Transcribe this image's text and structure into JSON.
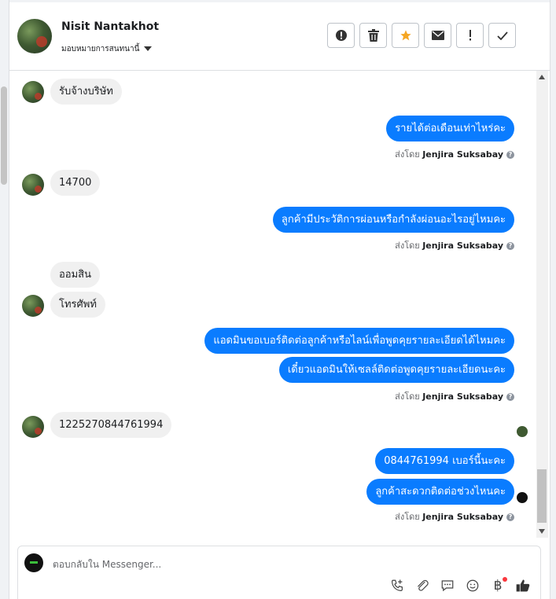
{
  "header": {
    "name": "Nisit Nantakhot",
    "assign_label": "มอบหมายการสนทนานี้",
    "actions": [
      "spam",
      "delete",
      "star",
      "mark-unread",
      "follow-up",
      "done"
    ]
  },
  "messages": {
    "m1": "รับจ้างบริษัท",
    "m2": "รายได้ต่อเดือนเท่าไหร่คะ",
    "m3": "14700",
    "m4": "ลูกค้ามีประวัติการผ่อนหรือกำลังผ่อนอะไรอยู่ไหมคะ",
    "m5": "ออมสิน",
    "m6": "โทรศัพท์",
    "m7": "แอดมินขอเบอร์ติดต่อลูกค้าหรือไลน์เพื่อพูดคุยรายละเอียดได้ไหมคะ",
    "m8": "เดี๋ยวแอดมินให้เซลล์ติดต่อพูดคุยรายละเอียดนะคะ",
    "m9": "1225270844761994",
    "m10": "0844761994 เบอร์นี้นะคะ",
    "m11": "ลูกค้าสะดวกติดต่อช่วงไหนคะ"
  },
  "sent_by": {
    "prefix": "ส่งโดย",
    "agent": "Jenjira Suksabay"
  },
  "composer": {
    "placeholder": "ตอบกลับใน Messenger..."
  },
  "colors": {
    "outgoing_bubble": "#0a7cff",
    "incoming_bubble": "#f0f0f0",
    "star": "#f5a623"
  }
}
